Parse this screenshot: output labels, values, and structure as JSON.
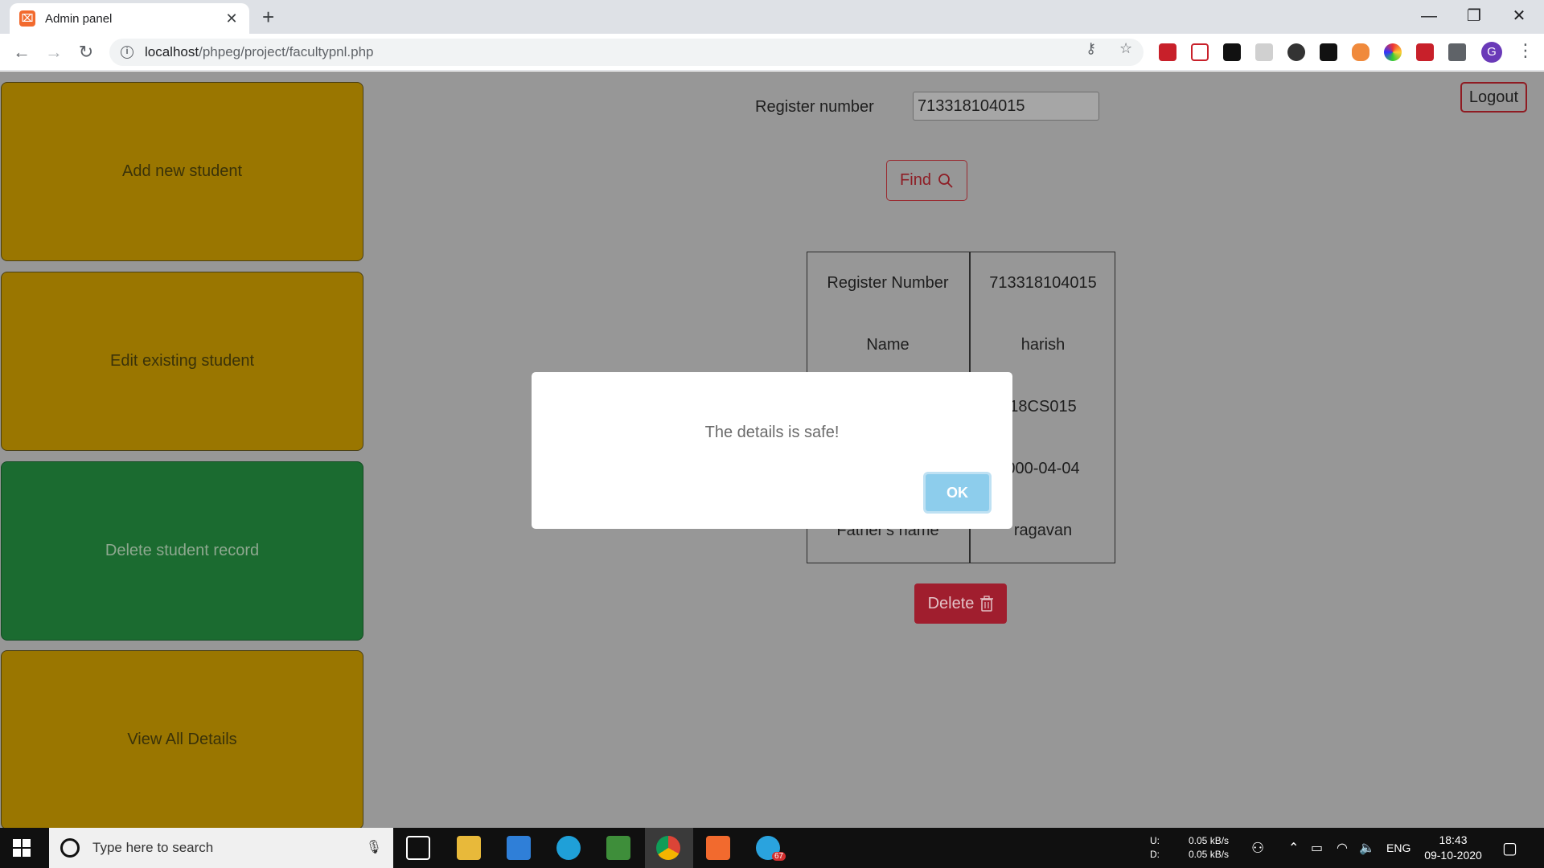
{
  "browser": {
    "tab_title": "Admin panel",
    "url_host": "localhost",
    "url_path": "/phpeg/project/facultypnl.php"
  },
  "sidebar": {
    "items": [
      {
        "label": "Add new student",
        "state": "default"
      },
      {
        "label": "Edit existing student",
        "state": "default"
      },
      {
        "label": "Delete student record",
        "state": "active"
      },
      {
        "label": "View All Details",
        "state": "default"
      }
    ]
  },
  "search": {
    "label": "Register number",
    "value": "713318104015",
    "find_label": "Find"
  },
  "header": {
    "logout_label": "Logout"
  },
  "details": {
    "rows": [
      {
        "label": "Register Number",
        "value": "713318104015"
      },
      {
        "label": "Name",
        "value": "harish"
      },
      {
        "label": "",
        "value": "18CS015"
      },
      {
        "label": "",
        "value": "000-04-04"
      },
      {
        "label": "Father's name",
        "value": "ragavan"
      }
    ],
    "delete_label": "Delete"
  },
  "modal": {
    "message": "The details is safe!",
    "ok_label": "OK"
  },
  "taskbar": {
    "search_placeholder": "Type here to search",
    "net_up_label": "U:",
    "net_down_label": "D:",
    "net_up": "0.05 kB/s",
    "net_down": "0.05 kB/s",
    "lang": "ENG",
    "time": "18:43",
    "date": "09-10-2020",
    "telegram_badge": "67"
  },
  "colors": {
    "sidebar_yellow": "#9a7600",
    "sidebar_green": "#1b6b30",
    "danger": "#a01e2e",
    "ok_button": "#8dcdec"
  }
}
